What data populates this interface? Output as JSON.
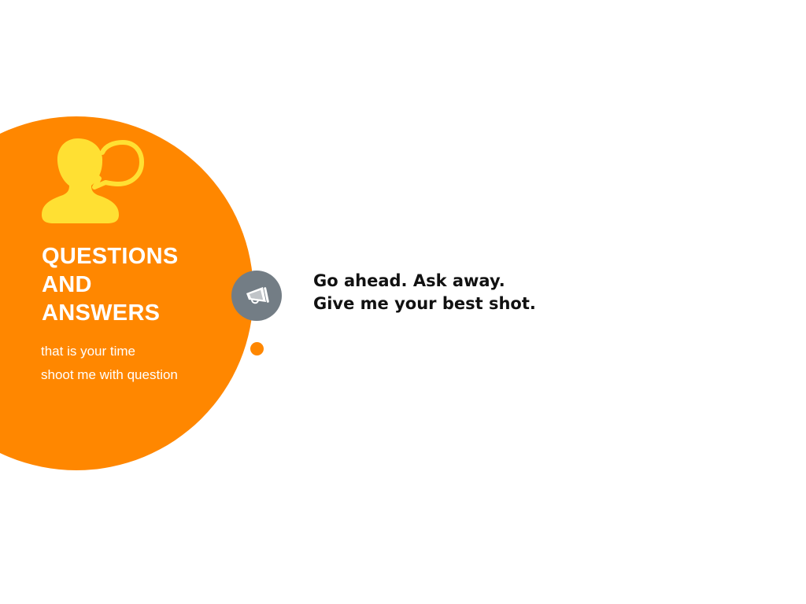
{
  "panel": {
    "icon": "person-speech-bubble-icon",
    "title_lines": [
      "QUESTIONS",
      "AND",
      "ANSWERS"
    ],
    "subtitle_lines": [
      "that is your time",
      "shoot me with question"
    ]
  },
  "badge": {
    "icon": "megaphone-icon"
  },
  "message": {
    "lines": [
      "Go ahead. Ask away.",
      "Give me your best shot."
    ]
  },
  "colors": {
    "accent": "#ff8700",
    "icon_yellow": "#ffe033",
    "badge_gray": "#737d85",
    "text_dark": "#111111",
    "text_light": "#ffffff"
  }
}
